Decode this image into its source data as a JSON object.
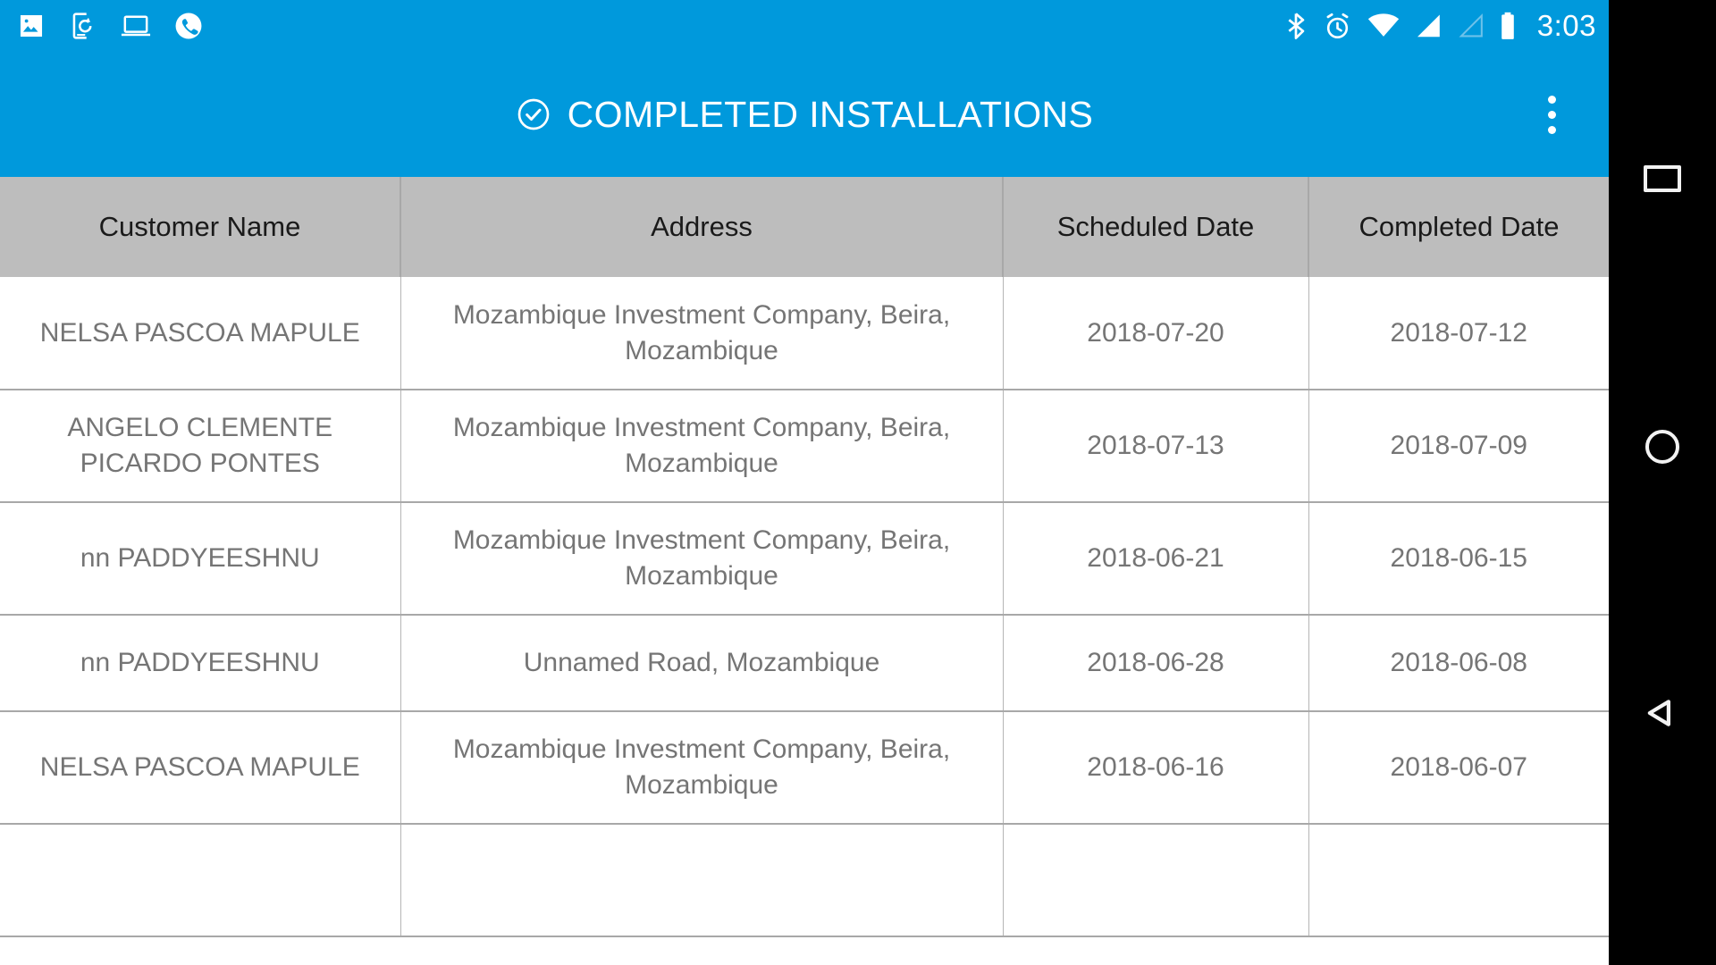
{
  "theme": {
    "primary": "#0099dc",
    "header_row_bg": "#bdbdbd",
    "row_text": "#757575",
    "nav_bar_bg": "#000000"
  },
  "status_bar": {
    "left_icons": [
      {
        "name": "image-icon",
        "label": "Screenshot"
      },
      {
        "name": "phone-sync-icon",
        "label": "USB file transfer"
      },
      {
        "name": "laptop-icon",
        "label": "Connected computer"
      },
      {
        "name": "phone-call-icon",
        "label": "Ongoing call"
      }
    ],
    "right_icons": [
      {
        "name": "bluetooth-icon",
        "label": "Bluetooth"
      },
      {
        "name": "alarm-icon",
        "label": "Alarm set"
      },
      {
        "name": "wifi-icon",
        "label": "Wi-Fi"
      },
      {
        "name": "signal-full-icon",
        "label": "Mobile signal SIM 1"
      },
      {
        "name": "signal-empty-icon",
        "label": "Mobile signal SIM 2"
      },
      {
        "name": "battery-icon",
        "label": "Battery"
      }
    ],
    "clock": "3:03"
  },
  "app_bar": {
    "icon": "check-circle-icon",
    "title": "COMPLETED INSTALLATIONS",
    "overflow_menu": "more-options"
  },
  "table": {
    "columns": [
      "Customer Name",
      "Address",
      "Scheduled Date",
      "Completed Date"
    ],
    "rows": [
      {
        "customer_name": "NELSA PASCOA MAPULE",
        "address": "Mozambique Investment Company, Beira, Mozambique",
        "scheduled_date": "2018-07-20",
        "completed_date": "2018-07-12"
      },
      {
        "customer_name": "ANGELO  CLEMENTE PICARDO PONTES",
        "address": "Mozambique Investment Company, Beira, Mozambique",
        "scheduled_date": "2018-07-13",
        "completed_date": "2018-07-09"
      },
      {
        "customer_name": "nn PADDYEESHNU",
        "address": "Mozambique Investment Company, Beira, Mozambique",
        "scheduled_date": "2018-06-21",
        "completed_date": "2018-06-15"
      },
      {
        "customer_name": "nn PADDYEESHNU",
        "address": "Unnamed Road, Mozambique",
        "scheduled_date": "2018-06-28",
        "completed_date": "2018-06-08"
      },
      {
        "customer_name": "NELSA PASCOA MAPULE",
        "address": "Mozambique Investment Company, Beira, Mozambique",
        "scheduled_date": "2018-06-16",
        "completed_date": "2018-06-07"
      },
      {
        "customer_name": "",
        "address": "",
        "scheduled_date": "",
        "completed_date": ""
      }
    ]
  },
  "nav_bar": {
    "buttons": [
      {
        "name": "recents-button",
        "label": "Overview"
      },
      {
        "name": "home-button",
        "label": "Home"
      },
      {
        "name": "back-button",
        "label": "Back"
      }
    ]
  }
}
